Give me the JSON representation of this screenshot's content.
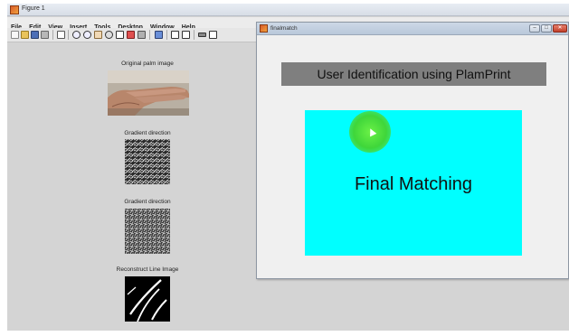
{
  "figure_window": {
    "title": "Figure 1",
    "menu": [
      "File",
      "Edit",
      "View",
      "Insert",
      "Tools",
      "Desktop",
      "Window",
      "Help"
    ],
    "toolbar_icons": [
      "new-figure-icon",
      "open-icon",
      "save-icon",
      "print-icon",
      "pointer-icon",
      "zoom-in-icon",
      "zoom-out-icon",
      "pan-icon",
      "rotate-icon",
      "data-cursor-icon",
      "brush-icon",
      "link-icon",
      "colorbar-icon",
      "legend-icon",
      "hide-plot-tools-icon",
      "show-plot-tools-icon"
    ],
    "subplots": [
      {
        "title": "Original palm image",
        "kind": "photo"
      },
      {
        "title": "Gradient direction",
        "kind": "noise"
      },
      {
        "title": "Gradient direction",
        "kind": "noise"
      },
      {
        "title": "Reconstruct Line Image",
        "kind": "lines"
      }
    ]
  },
  "finalmatch_window": {
    "title": "finalmatch",
    "controls": {
      "minimize": "–",
      "maximize": "□",
      "close": "✕"
    },
    "banner_text": "User Identification using PlamPrint",
    "panel_text": "Final Matching",
    "colors": {
      "banner_bg": "#7f7f7f",
      "panel_bg": "#00ffff",
      "cursor_halo": "#3fd63a"
    }
  }
}
